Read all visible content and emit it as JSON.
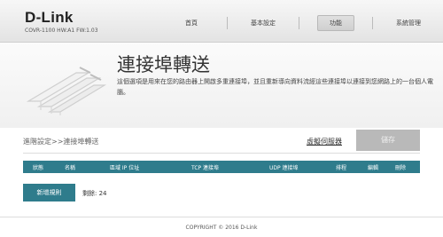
{
  "brand": {
    "logo": "D-Link",
    "model": "COVR-1100 HW:A1 FW:1.03"
  },
  "nav": {
    "home": "首頁",
    "basic": "基本設定",
    "features": "功能",
    "admin": "系統管理"
  },
  "page": {
    "title": "連接埠轉送",
    "description": "這個選項是用來在您的路由器上開啟多重連接埠，並且重新導向資料流經這些連接埠以連接到您網路上的一台個人電腦。"
  },
  "subbar": {
    "breadcrumb": "進階設定>>連接埠轉送",
    "virtual_server": "虛擬伺服器",
    "save": "儲存"
  },
  "table": {
    "headers": {
      "status": "狀態",
      "name": "名稱",
      "local_ip": "區域 IP 位址",
      "tcp": "TCP 連接埠",
      "udp": "UDP 連接埠",
      "schedule": "排程",
      "edit": "編輯",
      "delete": "刪除"
    }
  },
  "actions": {
    "add_rule": "新增規則",
    "remaining": "剩餘: 24"
  },
  "footer": {
    "copyright": "COPYRIGHT © 2016 D-Link"
  },
  "colors": {
    "accent": "#2f7c8c",
    "disabled": "#b9b9b9"
  }
}
